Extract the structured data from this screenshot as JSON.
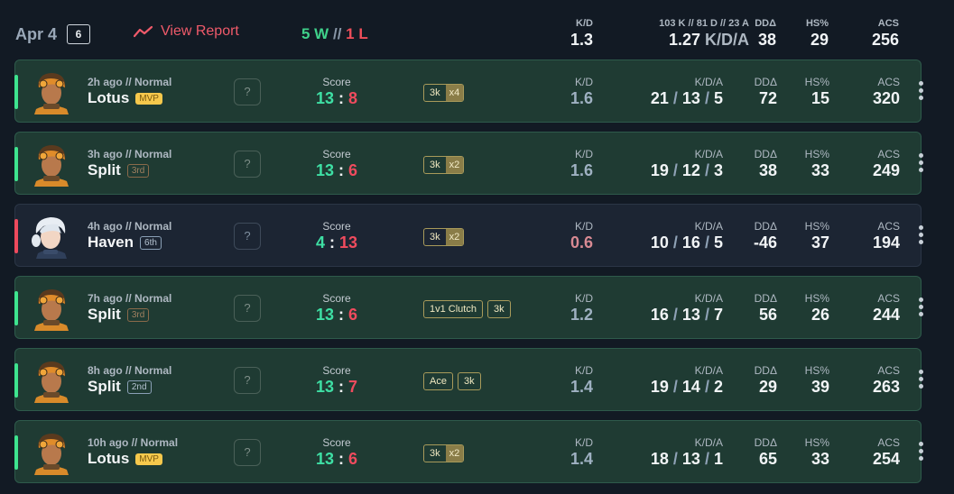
{
  "header": {
    "date": "Apr 4",
    "count": "6",
    "view_report": "View Report",
    "wins": "5 W",
    "separator": "//",
    "losses": "1 L",
    "kd_label": "K/D",
    "kd_value": "1.3",
    "kda_label": "103 K // 81 D // 23 A",
    "kda_value": "1.27",
    "kda_unit": "K/D/A",
    "dd_label": "DDΔ",
    "dd_value": "38",
    "hs_label": "HS%",
    "hs_value": "29",
    "acs_label": "ACS",
    "acs_value": "256"
  },
  "labels": {
    "score": "Score",
    "kd": "K/D",
    "kda": "K/D/A",
    "dd": "DDΔ",
    "hs": "HS%",
    "acs": "ACS",
    "unknown_rank": "?",
    "colon": ":",
    "slash": "/"
  },
  "matches": [
    {
      "result": "win",
      "agent_icon": "agent-raze-icon",
      "ago": "2h ago // Normal",
      "map": "Lotus",
      "placement": "MVP",
      "score_us": "13",
      "score_them": "8",
      "badges": [
        {
          "text": "3k",
          "mult": "x4"
        }
      ],
      "kd": "1.6",
      "k": "21",
      "d": "13",
      "a": "5",
      "dd": "72",
      "hs": "15",
      "acs": "320"
    },
    {
      "result": "win",
      "agent_icon": "agent-raze-icon",
      "ago": "3h ago // Normal",
      "map": "Split",
      "placement": "3rd",
      "score_us": "13",
      "score_them": "6",
      "badges": [
        {
          "text": "3k",
          "mult": "x2"
        }
      ],
      "kd": "1.6",
      "k": "19",
      "d": "12",
      "a": "3",
      "dd": "38",
      "hs": "33",
      "acs": "249"
    },
    {
      "result": "loss",
      "agent_icon": "agent-jett-icon",
      "ago": "4h ago // Normal",
      "map": "Haven",
      "placement": "6th",
      "score_us": "4",
      "score_them": "13",
      "badges": [
        {
          "text": "3k",
          "mult": "x2"
        }
      ],
      "kd": "0.6",
      "k": "10",
      "d": "16",
      "a": "5",
      "dd": "-46",
      "hs": "37",
      "acs": "194"
    },
    {
      "result": "win",
      "agent_icon": "agent-raze-icon",
      "ago": "7h ago // Normal",
      "map": "Split",
      "placement": "3rd",
      "score_us": "13",
      "score_them": "6",
      "badges": [
        {
          "text": "1v1 Clutch",
          "mult": ""
        },
        {
          "text": "3k",
          "mult": ""
        }
      ],
      "kd": "1.2",
      "k": "16",
      "d": "13",
      "a": "7",
      "dd": "56",
      "hs": "26",
      "acs": "244"
    },
    {
      "result": "win",
      "agent_icon": "agent-raze-icon",
      "ago": "8h ago // Normal",
      "map": "Split",
      "placement": "2nd",
      "score_us": "13",
      "score_them": "7",
      "badges": [
        {
          "text": "Ace",
          "mult": ""
        },
        {
          "text": "3k",
          "mult": ""
        }
      ],
      "kd": "1.4",
      "k": "19",
      "d": "14",
      "a": "2",
      "dd": "29",
      "hs": "39",
      "acs": "263"
    },
    {
      "result": "win",
      "agent_icon": "agent-raze-icon",
      "ago": "10h ago // Normal",
      "map": "Lotus",
      "placement": "MVP",
      "score_us": "13",
      "score_them": "6",
      "badges": [
        {
          "text": "3k",
          "mult": "x2"
        }
      ],
      "kd": "1.4",
      "k": "18",
      "d": "13",
      "a": "1",
      "dd": "65",
      "hs": "33",
      "acs": "254"
    }
  ],
  "colors": {
    "win_accent": "#3ee48f",
    "loss_accent": "#ee4a5d",
    "report_red": "#ef5a6a",
    "mvp_gold": "#f6c84c"
  }
}
